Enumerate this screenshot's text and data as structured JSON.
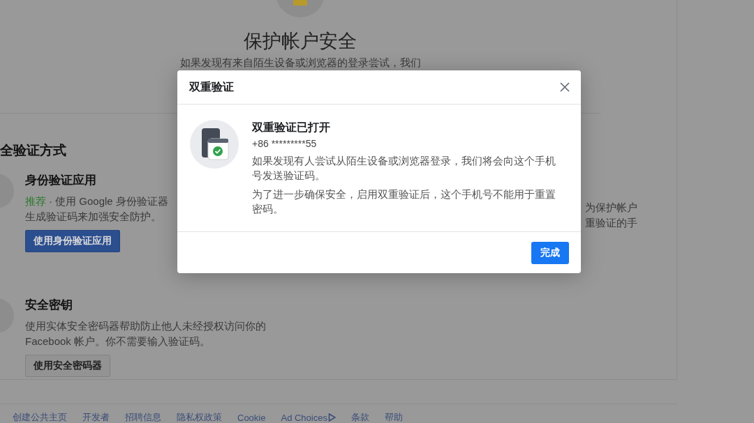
{
  "page": {
    "title": "保护帐户安全",
    "subtitle": "如果发现有来自陌生设备或浏览器的登录尝试，我们",
    "section_title": "全验证方式",
    "methods": [
      {
        "kind": "primary",
        "title": "身份验证应用",
        "badge": "推荐",
        "lines": [
          "· 使用 Google 身份验证器",
          "生成验证码来加强安全防护。"
        ],
        "button": "使用身份验证应用"
      },
      {
        "kind": "secondary",
        "title": "安全密钥",
        "lines": [
          "使用实体安全密码器帮助防止他人未经授权访问你的",
          "Facebook 帐户。你不需要输入验证码。"
        ],
        "button": "使用安全密码器"
      }
    ],
    "side_lines": [
      "为保护帐户",
      "重验证的手"
    ]
  },
  "footer": {
    "links": [
      {
        "label": "创建公共主页"
      },
      {
        "label": "开发者"
      },
      {
        "label": "招聘信息"
      },
      {
        "label": "隐私权政策"
      },
      {
        "label": "Cookie"
      },
      {
        "label": "Ad Choices",
        "kind": "adchoices"
      },
      {
        "label": "条款"
      },
      {
        "label": "帮助"
      }
    ]
  },
  "dialog": {
    "title": "双重验证",
    "heading": "双重验证已打开",
    "phone": "+86 *********55",
    "paragraphs": [
      "如果发现有人尝试从陌生设备或浏览器登录，我们将会向这个手机号发送验证码。",
      "为了进一步确保安全，启用双重验证后，这个手机号不能用于重置密码。"
    ],
    "button": "完成"
  }
}
